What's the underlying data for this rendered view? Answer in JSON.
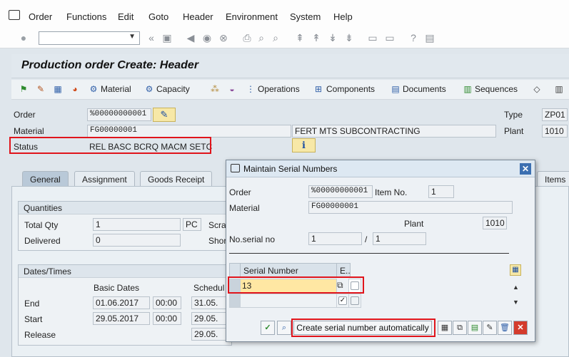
{
  "menu": {
    "items": [
      "Order",
      "Functions",
      "Edit",
      "Goto",
      "Header",
      "Environment",
      "System",
      "Help"
    ]
  },
  "title": "Production order Create: Header",
  "app_toolbar": {
    "material": "Material",
    "capacity": "Capacity",
    "operations": "Operations",
    "components": "Components",
    "documents": "Documents",
    "sequences": "Sequences"
  },
  "header": {
    "order_label": "Order",
    "order_value": "%00000000001",
    "material_label": "Material",
    "material_value": "FG00000001",
    "material_desc": "FERT MTS SUBCONTRACTING",
    "status_label": "Status",
    "status_value": "REL  BASC BCRQ MACM SETC",
    "type_label": "Type",
    "type_value": "ZP01",
    "plant_label": "Plant",
    "plant_value": "1010"
  },
  "tabs": [
    "General",
    "Assignment",
    "Goods Receipt",
    "Items"
  ],
  "quantities": {
    "title": "Quantities",
    "total_qty_label": "Total Qty",
    "total_qty_value": "1",
    "unit": "PC",
    "scrap_label": "Scra",
    "delivered_label": "Delivered",
    "delivered_value": "0",
    "short_label": "Shor"
  },
  "dates": {
    "title": "Dates/Times",
    "basic_dates": "Basic Dates",
    "scheduled": "Schedul",
    "end_label": "End",
    "end_date": "01.06.2017",
    "end_time": "00:00",
    "end_sched": "31.05.",
    "start_label": "Start",
    "start_date": "29.05.2017",
    "start_time": "00:00",
    "start_sched": "29.05.",
    "release_label": "Release",
    "release_sched": "29.05."
  },
  "dialog": {
    "title": "Maintain Serial Numbers",
    "order_label": "Order",
    "order_value": "%00000000001",
    "item_no_label": "Item No.",
    "item_no_value": "1",
    "material_label": "Material",
    "material_value": "FG00000001",
    "plant_label": "Plant",
    "plant_value": "1010",
    "serial_no_label": "No.serial no",
    "serial_no_value": "1",
    "serial_no_sep": "/",
    "serial_no_total": "1",
    "table": {
      "col_serial": "Serial Number",
      "col_e": "E..",
      "rows": [
        {
          "serial": "13",
          "e": false
        },
        {
          "serial": "",
          "e": true
        }
      ]
    },
    "create_auto_label": "Create serial number automatically"
  },
  "colors": {
    "highlight": "#e0141b",
    "active_tab": "#b9c9d8",
    "input_active": "#ffe7a3"
  }
}
